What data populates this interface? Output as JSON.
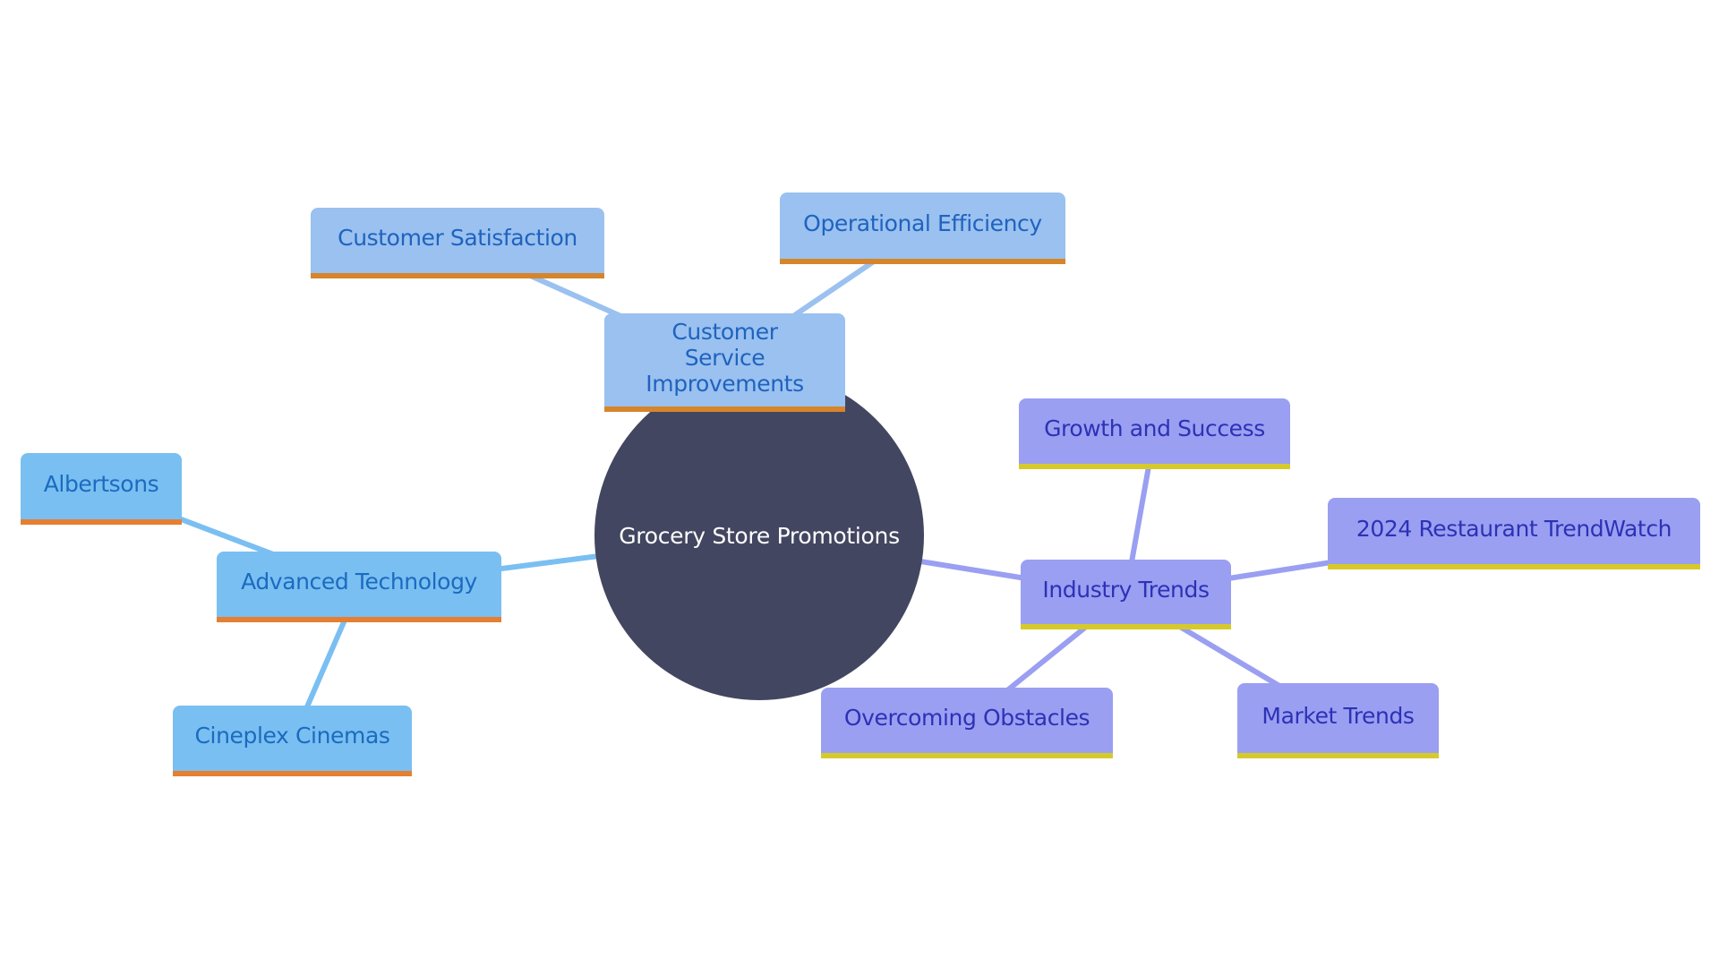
{
  "diagram": {
    "type": "mind-map",
    "root": {
      "label": "Grocery Store Promotions",
      "color": "#424660"
    },
    "branches": [
      {
        "id": "csi",
        "label": "Customer Service Improvements",
        "colors": {
          "fill": "#9AC1F0",
          "text": "#1F63BE",
          "accent": "#D7852B",
          "edge": "#9AC1F0"
        },
        "children": [
          {
            "id": "cs",
            "label": "Customer Satisfaction"
          },
          {
            "id": "oe",
            "label": "Operational Efficiency"
          }
        ]
      },
      {
        "id": "at",
        "label": "Advanced Technology",
        "colors": {
          "fill": "#7ABFF2",
          "text": "#1B6BBF",
          "accent": "#E57F31",
          "edge": "#7ABFF2"
        },
        "children": [
          {
            "id": "alb",
            "label": "Albertsons"
          },
          {
            "id": "cc",
            "label": "Cineplex Cinemas"
          }
        ]
      },
      {
        "id": "it",
        "label": "Industry Trends",
        "colors": {
          "fill": "#9A9FF2",
          "text": "#2C32B5",
          "accent": "#D6CA2A",
          "edge": "#9A9FF2"
        },
        "children": [
          {
            "id": "gs",
            "label": "Growth and Success"
          },
          {
            "id": "rtw",
            "label": "2024 Restaurant TrendWatch"
          },
          {
            "id": "oo",
            "label": "Overcoming Obstacles"
          },
          {
            "id": "mt",
            "label": "Market Trends"
          }
        ]
      }
    ]
  }
}
